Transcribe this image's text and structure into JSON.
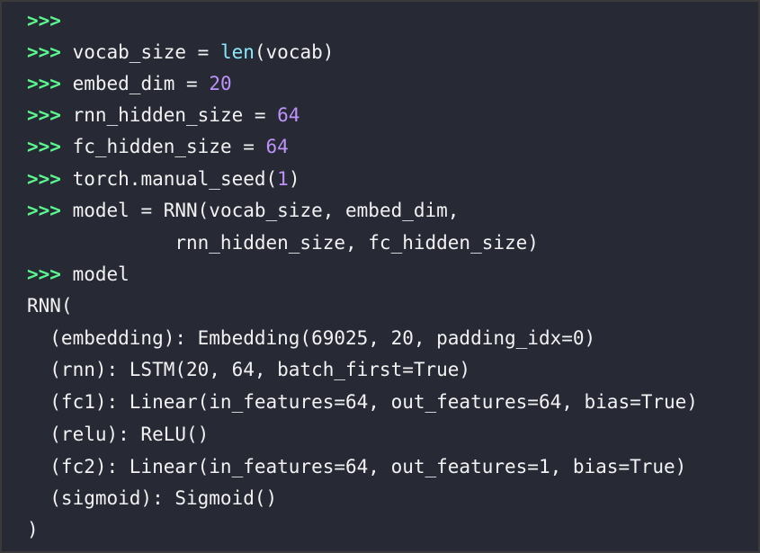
{
  "colors": {
    "background": "#272935",
    "prompt": "#5af78e",
    "text": "#f2f2f2",
    "builtin": "#8be9fd",
    "number": "#bd93f9"
  },
  "lines": [
    {
      "segments": [
        {
          "t": ">>>",
          "c": "prompt"
        }
      ]
    },
    {
      "segments": [
        {
          "t": ">>>",
          "c": "prompt"
        },
        {
          "t": " vocab_size = ",
          "c": "plain"
        },
        {
          "t": "len",
          "c": "fn"
        },
        {
          "t": "(vocab)",
          "c": "plain"
        }
      ]
    },
    {
      "segments": [
        {
          "t": ">>>",
          "c": "prompt"
        },
        {
          "t": " embed_dim = ",
          "c": "plain"
        },
        {
          "t": "20",
          "c": "num"
        }
      ]
    },
    {
      "segments": [
        {
          "t": ">>>",
          "c": "prompt"
        },
        {
          "t": " rnn_hidden_size = ",
          "c": "plain"
        },
        {
          "t": "64",
          "c": "num"
        }
      ]
    },
    {
      "segments": [
        {
          "t": ">>>",
          "c": "prompt"
        },
        {
          "t": " fc_hidden_size = ",
          "c": "plain"
        },
        {
          "t": "64",
          "c": "num"
        }
      ]
    },
    {
      "segments": [
        {
          "t": ">>>",
          "c": "prompt"
        },
        {
          "t": " torch.manual_seed(",
          "c": "plain"
        },
        {
          "t": "1",
          "c": "num"
        },
        {
          "t": ")",
          "c": "plain"
        }
      ]
    },
    {
      "segments": [
        {
          "t": ">>>",
          "c": "prompt"
        },
        {
          "t": " model = RNN(vocab_size, embed_dim,",
          "c": "plain"
        }
      ]
    },
    {
      "segments": [
        {
          "t": "             rnn_hidden_size, fc_hidden_size)",
          "c": "plain"
        }
      ]
    },
    {
      "segments": [
        {
          "t": ">>>",
          "c": "prompt"
        },
        {
          "t": " model",
          "c": "plain"
        }
      ]
    },
    {
      "segments": [
        {
          "t": "RNN(",
          "c": "plain"
        }
      ]
    },
    {
      "segments": [
        {
          "t": "  (embedding): Embedding(69025, 20, padding_idx=0)",
          "c": "plain"
        }
      ]
    },
    {
      "segments": [
        {
          "t": "  (rnn): LSTM(20, 64, batch_first=True)",
          "c": "plain"
        }
      ]
    },
    {
      "segments": [
        {
          "t": "  (fc1): Linear(in_features=64, out_features=64, bias=True)",
          "c": "plain"
        }
      ]
    },
    {
      "segments": [
        {
          "t": "  (relu): ReLU()",
          "c": "plain"
        }
      ]
    },
    {
      "segments": [
        {
          "t": "  (fc2): Linear(in_features=64, out_features=1, bias=True)",
          "c": "plain"
        }
      ]
    },
    {
      "segments": [
        {
          "t": "  (sigmoid): Sigmoid()",
          "c": "plain"
        }
      ]
    },
    {
      "segments": [
        {
          "t": ")",
          "c": "plain"
        }
      ]
    }
  ]
}
